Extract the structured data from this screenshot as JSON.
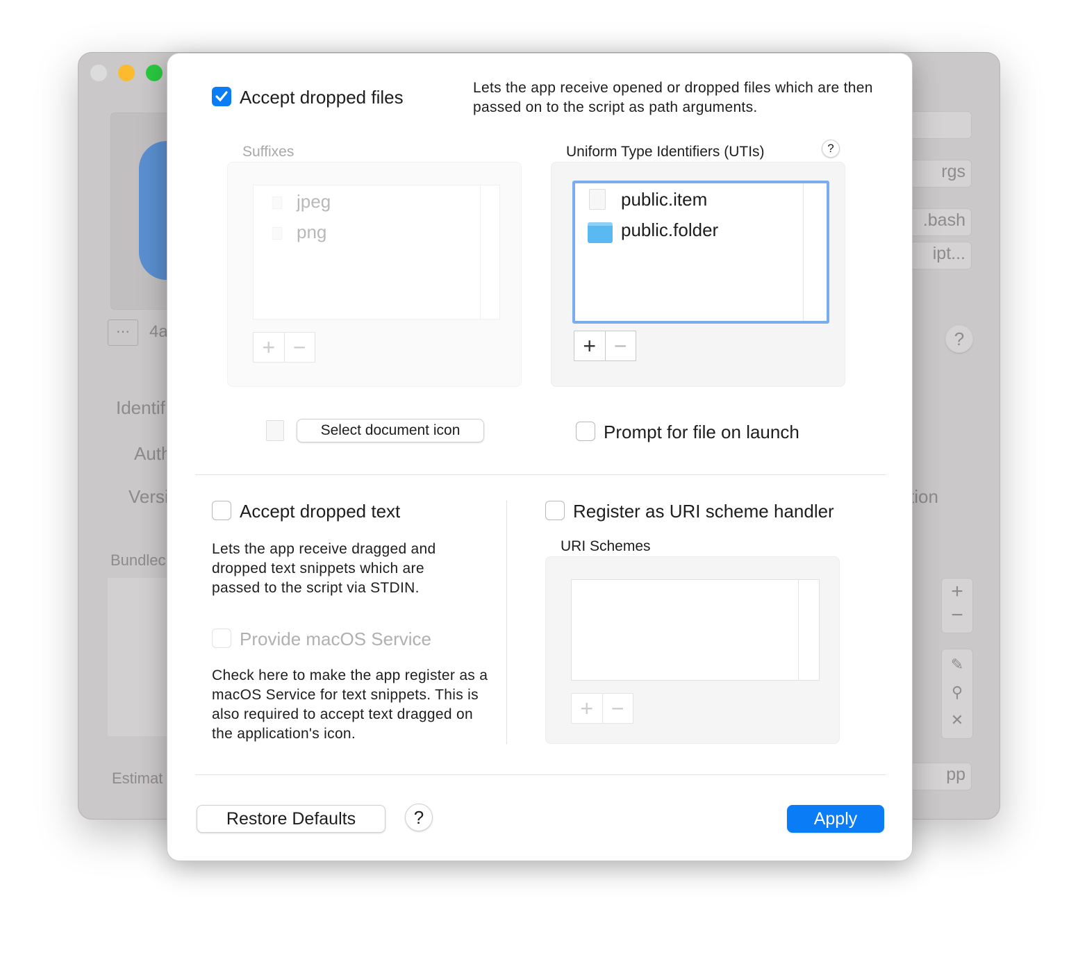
{
  "background_window": {
    "labels": [
      "4a",
      "Identif",
      "Auth",
      "Versi",
      "Bundlec",
      "Estimat"
    ],
    "buttons": [
      "rgs",
      ".bash",
      "ipt...",
      "tion",
      "pp"
    ],
    "traffic_lights": [
      "#dcdcdc",
      "#fbbb2e",
      "#2ac840"
    ]
  },
  "files": {
    "accept_label": "Accept dropped files",
    "accept_checked": true,
    "description": "Lets the app receive opened or dropped files which are then passed on to the script as path arguments.",
    "suffixes_title": "Suffixes",
    "suffixes": [
      "jpeg",
      "png"
    ],
    "utis_title": "Uniform Type Identifiers (UTIs)",
    "utis": [
      "public.item",
      "public.folder"
    ],
    "help": "?",
    "add": "+",
    "remove": "−",
    "select_icon_button": "Select document icon",
    "prompt_label": "Prompt for file on launch",
    "prompt_checked": false
  },
  "text": {
    "accept_label": "Accept dropped text",
    "accept_checked": false,
    "description": "Lets the app receive dragged and dropped text snippets which are passed to the script via STDIN.",
    "service_label": "Provide macOS Service",
    "service_checked": false,
    "service_description": "Check here to make the app register as a macOS Service for text snippets. This is also required to accept text dragged on the application's icon."
  },
  "uri": {
    "register_label": "Register as URI scheme handler",
    "register_checked": false,
    "schemes_title": "URI Schemes",
    "schemes": []
  },
  "footer": {
    "restore": "Restore Defaults",
    "help": "?",
    "apply": "Apply"
  },
  "colors": {
    "accent": "#0a7cf5",
    "focus_ring": "#7aacf0",
    "folder": "#5ab8f2"
  }
}
